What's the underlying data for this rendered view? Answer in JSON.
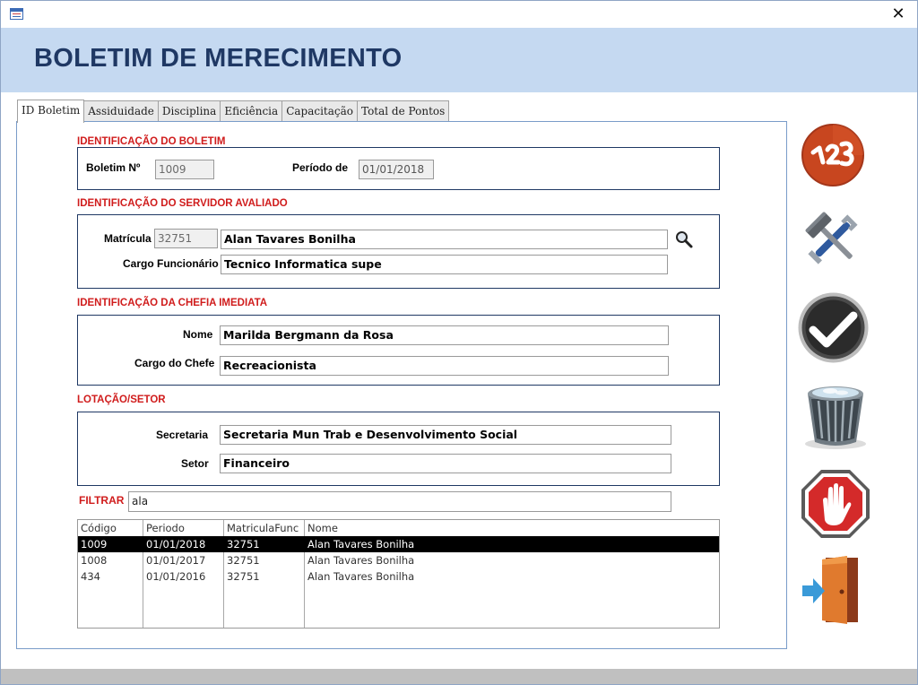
{
  "window": {
    "close_glyph": "✕"
  },
  "header": {
    "title": "BOLETIM DE MERECIMENTO"
  },
  "tabs": [
    {
      "label": "ID Boletim",
      "active": true
    },
    {
      "label": "Assiduidade",
      "active": false
    },
    {
      "label": "Disciplina",
      "active": false
    },
    {
      "label": "Eficiência",
      "active": false
    },
    {
      "label": "Capacitação",
      "active": false
    },
    {
      "label": "Total de Pontos",
      "active": false
    }
  ],
  "sections": {
    "boletim": {
      "title": "IDENTIFICAÇÃO DO BOLETIM",
      "numero_label": "Boletim Nº",
      "numero_value": "1009",
      "periodo_label": "Período de",
      "periodo_value": "01/01/2018"
    },
    "servidor": {
      "title": "IDENTIFICAÇÃO DO SERVIDOR AVALIADO",
      "matricula_label": "Matrícula",
      "matricula_value": "32751",
      "nome_value": "Alan Tavares Bonilha",
      "cargo_label": "Cargo Funcionário",
      "cargo_value": "Tecnico Informatica supe"
    },
    "chefia": {
      "title": "IDENTIFICAÇÃO DA CHEFIA IMEDIATA",
      "nome_label": "Nome",
      "nome_value": "Marilda Bergmann da Rosa",
      "cargo_label": "Cargo do Chefe",
      "cargo_value": "Recreacionista"
    },
    "lotacao": {
      "title": "LOTAÇÃO/SETOR",
      "secretaria_label": "Secretaria",
      "secretaria_value": "Secretaria Mun Trab e Desenvolvimento Social",
      "setor_label": "Setor",
      "setor_value": "Financeiro"
    }
  },
  "filter": {
    "label": "FILTRAR",
    "value": "ala"
  },
  "list": {
    "columns": [
      "Código",
      "Periodo",
      "MatriculaFunc",
      "Nome"
    ],
    "rows": [
      [
        "1009",
        "01/01/2018",
        "32751",
        "Alan Tavares Bonilha"
      ],
      [
        "1008",
        "01/01/2017",
        "32751",
        "Alan Tavares Bonilha"
      ],
      [
        "434",
        "01/01/2016",
        "32751",
        "Alan Tavares Bonilha"
      ]
    ],
    "selected_index": 0
  },
  "actions": [
    {
      "name": "numbering-button",
      "icon": "numbers-123-icon"
    },
    {
      "name": "tools-button",
      "icon": "wrench-hammer-icon"
    },
    {
      "name": "confirm-button",
      "icon": "checkmark-icon"
    },
    {
      "name": "delete-button",
      "icon": "trash-bin-icon"
    },
    {
      "name": "stop-button",
      "icon": "stop-hand-icon"
    },
    {
      "name": "exit-button",
      "icon": "exit-door-icon"
    }
  ],
  "colors": {
    "header_bg": "#c5d9f1",
    "title": "#1f3864",
    "section_label": "#d01c1c",
    "group_border": "#1f3864"
  }
}
